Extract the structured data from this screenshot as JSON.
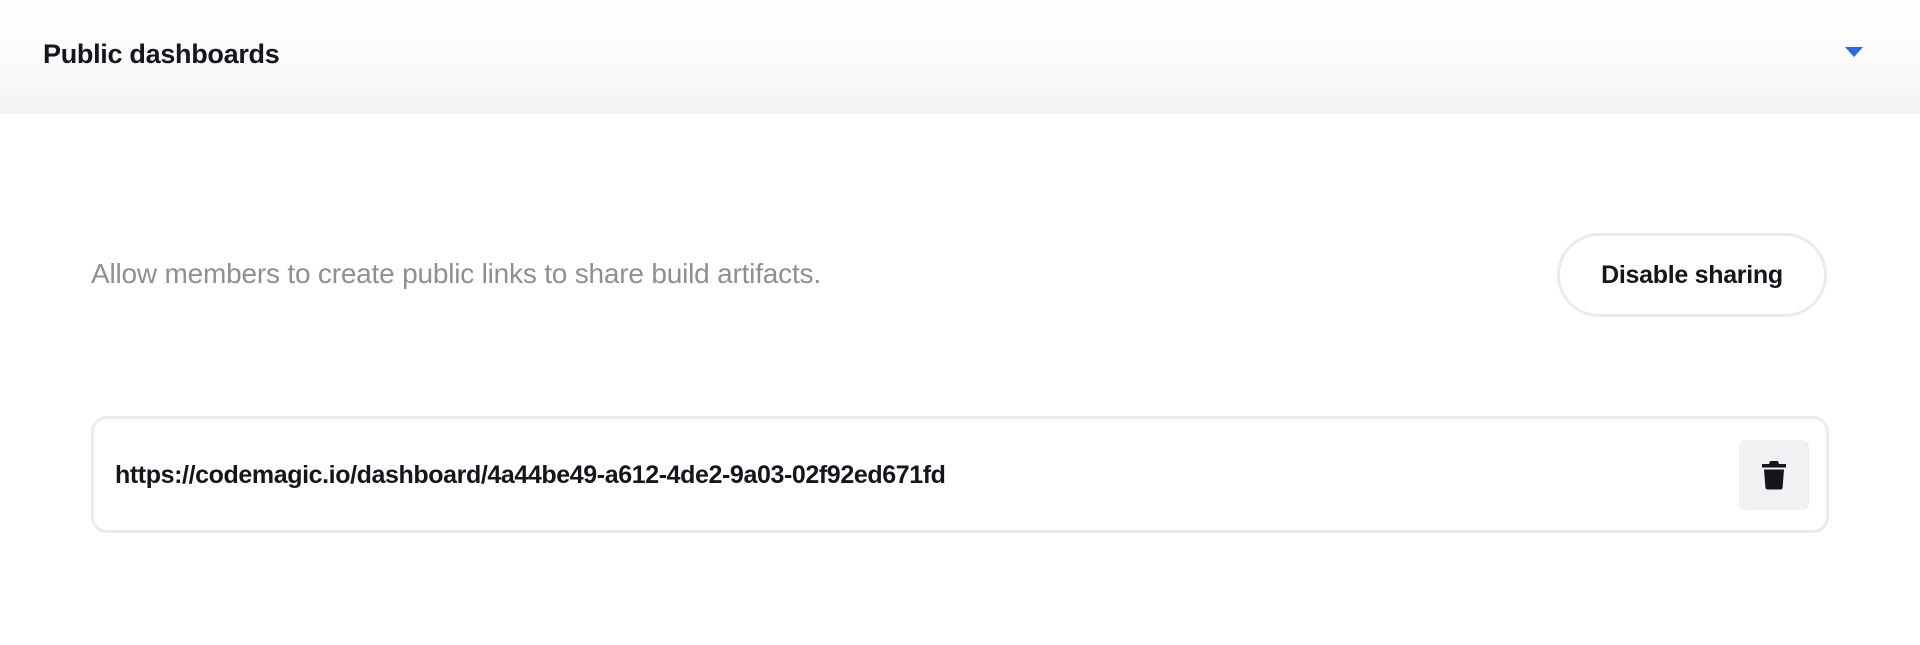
{
  "section": {
    "title": "Public dashboards",
    "toggle_icon": "caret-down-icon",
    "accent_color": "#2d66ee"
  },
  "sharing": {
    "description": "Allow members to create public links to share build artifacts.",
    "disable_button_label": "Disable sharing"
  },
  "links": [
    {
      "url": "https://codemagic.io/dashboard/4a44be49-a612-4de2-9a03-02f92ed671fd",
      "delete_icon": "trash-icon"
    }
  ]
}
